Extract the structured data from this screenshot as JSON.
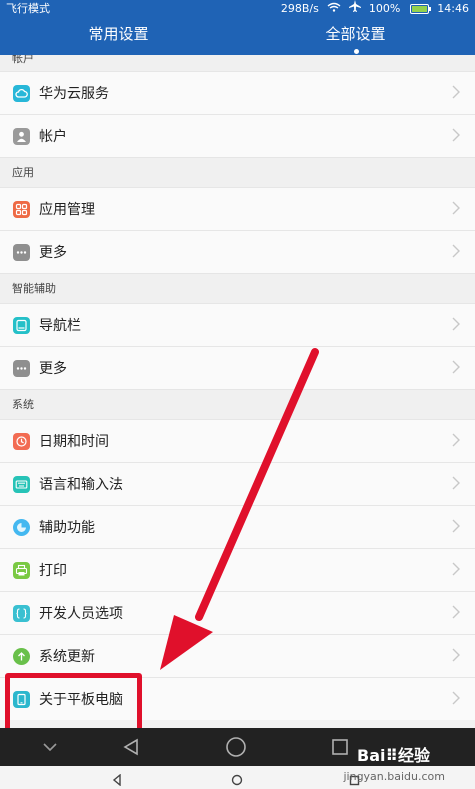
{
  "status": {
    "left": "飞行模式",
    "speed": "298B/s",
    "battery": "100%",
    "time": "14:46"
  },
  "tabs": {
    "common": "常用设置",
    "all": "全部设置"
  },
  "sections": {
    "account": "帐户",
    "apps": "应用",
    "assist": "智能辅助",
    "system": "系统"
  },
  "items": {
    "huawei_cloud": "华为云服务",
    "account": "帐户",
    "app_manage": "应用管理",
    "apps_more": "更多",
    "navbar": "导航栏",
    "assist_more": "更多",
    "datetime": "日期和时间",
    "language": "语言和输入法",
    "accessibility": "辅助功能",
    "print": "打印",
    "developer": "开发人员选项",
    "update": "系统更新",
    "about": "关于平板电脑"
  },
  "icons": {
    "huawei_cloud": "cloud-icon",
    "account": "person-icon",
    "app_manage": "app-grid-icon",
    "more": "more-icon",
    "navbar": "navbar-icon",
    "datetime": "clock-icon",
    "language": "keyboard-icon",
    "accessibility": "accessibility-icon",
    "print": "printer-icon",
    "developer": "developer-icon",
    "update": "update-icon",
    "about": "tablet-icon"
  },
  "colors": {
    "header": "#1f63b5",
    "cloud": "#28b7d8",
    "account": "#9a9a9a",
    "apps": "#ee6a45",
    "more": "#8f8f8f",
    "navbar": "#25c0c8",
    "datetime": "#f26b52",
    "language": "#27c3b7",
    "accessibility": "#44b8f0",
    "print": "#7ac943",
    "developer": "#3ac0d1",
    "update": "#69c04a",
    "about": "#2bb7cd",
    "highlight": "#e0102b"
  },
  "watermark": {
    "brand": "Bai⠿经验",
    "url": "jingyan.baidu.com"
  }
}
